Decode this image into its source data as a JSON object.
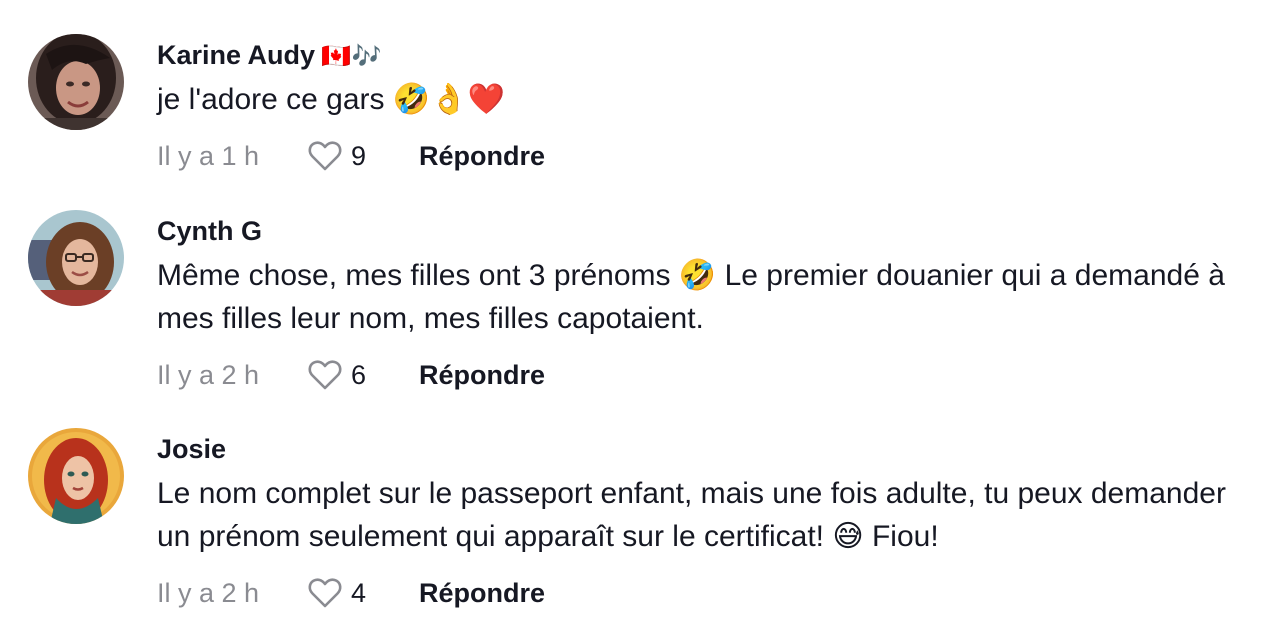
{
  "reply_label": "Répondre",
  "comments": [
    {
      "username": "Karine Audy",
      "username_decoration": "🇨🇦🎶",
      "text": "je l'adore ce gars 🤣👌❤️",
      "time": "Il y a 1 h",
      "likes": "9",
      "avatar_icon": "profile-photo-dark-hair"
    },
    {
      "username": "Cynth G",
      "username_decoration": "",
      "text": "Même chose, mes filles ont 3 prénoms 🤣 Le premier douanier qui a demandé à mes filles leur nom, mes filles capotaient.",
      "time": "Il y a 2 h",
      "likes": "6",
      "avatar_icon": "profile-photo-curly-hair-glasses"
    },
    {
      "username": "Josie",
      "username_decoration": "",
      "text": "Le nom complet sur le passeport enfant, mais une fois adulte, tu peux demander un prénom seulement qui apparaît sur le certificat! 😅 Fiou!",
      "time": "Il y a 2 h",
      "likes": "4",
      "avatar_icon": "illustrated-red-hair-portrait"
    }
  ],
  "colors": {
    "text": "#161823",
    "muted": "#8a8b91",
    "background": "#ffffff"
  }
}
